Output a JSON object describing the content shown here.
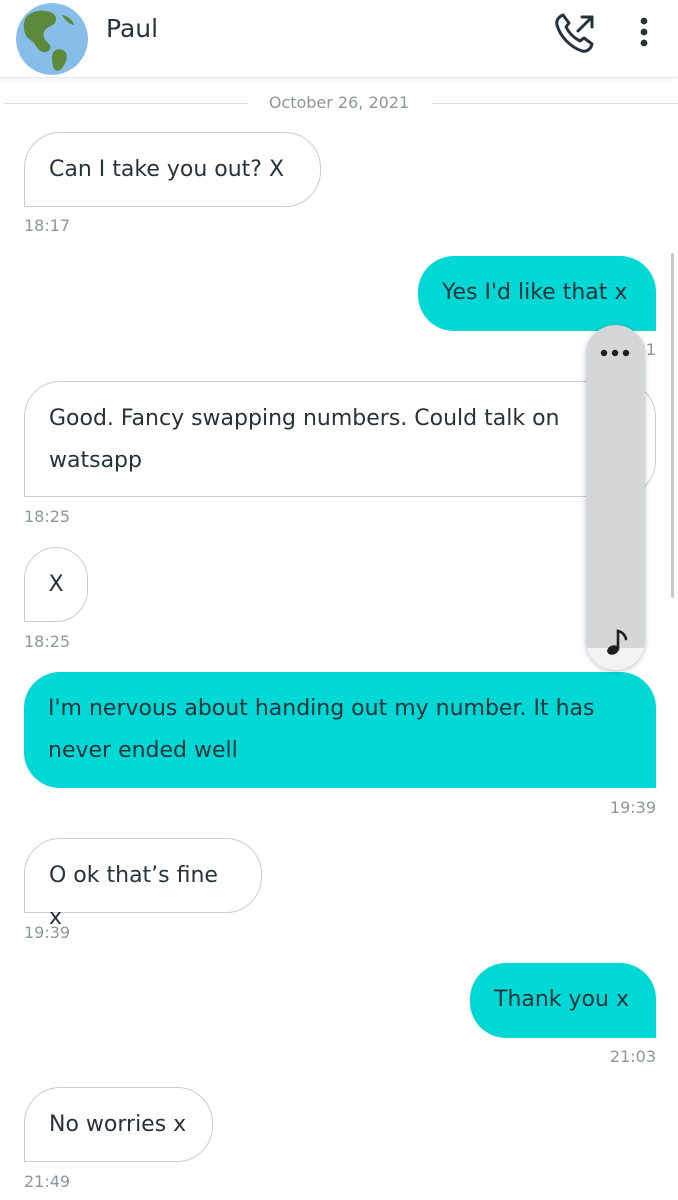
{
  "header": {
    "contact_name": "Paul",
    "avatar_icon": "earth-globe-icon",
    "call_icon": "phone-call-icon",
    "more_icon": "more-vertical-icon"
  },
  "date_separator": "October 26, 2021",
  "messages": [
    {
      "direction": "in",
      "text_lines": [
        "Can I take you out? X"
      ],
      "time": "18:17"
    },
    {
      "direction": "out",
      "text_lines": [
        "Yes I'd like that x"
      ],
      "time": "21"
    },
    {
      "direction": "in",
      "text_lines": [
        "Good. Fancy swapping numbers. Could talk on",
        "watsapp"
      ],
      "time": "18:25"
    },
    {
      "direction": "in",
      "text_lines": [
        "X"
      ],
      "time": "18:25"
    },
    {
      "direction": "out",
      "text_lines": [
        "I'm nervous about handing out my number. It has",
        "never ended well"
      ],
      "time": "19:39"
    },
    {
      "direction": "in",
      "text_lines": [
        "O ok that’s fine x"
      ],
      "time": "19:39"
    },
    {
      "direction": "out",
      "text_lines": [
        "Thank you x"
      ],
      "time": "21:03"
    },
    {
      "direction": "in",
      "text_lines": [
        "No worries x"
      ],
      "time": "21:49"
    }
  ],
  "overlay": {
    "dots_icon": "more-horizontal-icon",
    "note_icon": "music-note-icon"
  },
  "colors": {
    "outgoing_bubble": "#00d8d6",
    "incoming_border": "#c7ced2",
    "text": "#27323a",
    "timestamp": "#8c969c"
  }
}
